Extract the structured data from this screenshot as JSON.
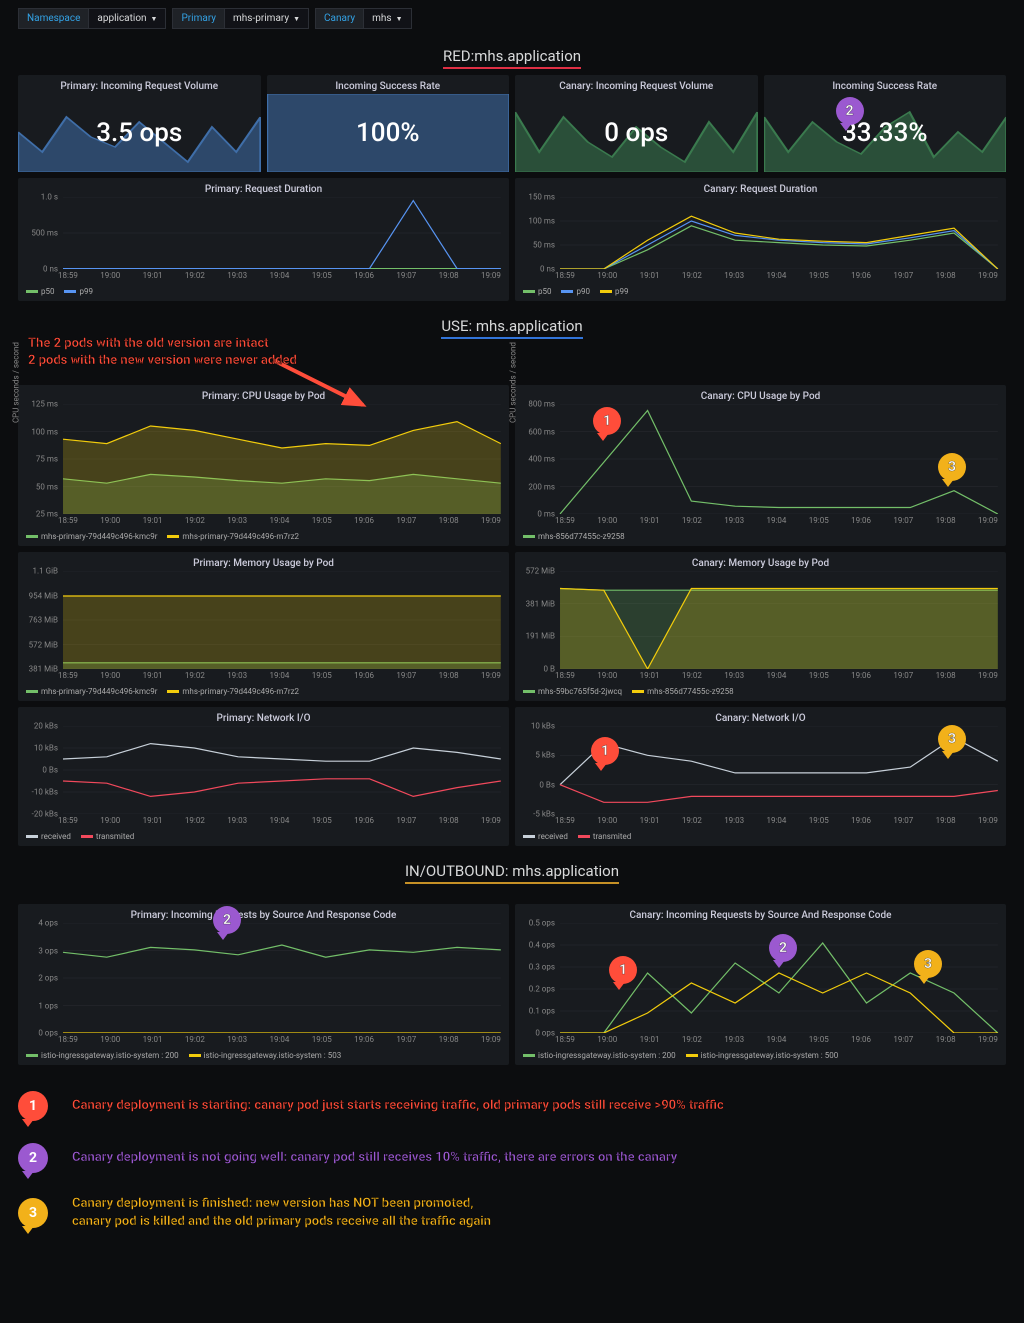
{
  "filters": {
    "namespace": {
      "label": "Namespace",
      "value": "application"
    },
    "primary": {
      "label": "Primary",
      "value": "mhs-primary"
    },
    "canary": {
      "label": "Canary",
      "value": "mhs"
    }
  },
  "sections": {
    "red": "RED:mhs.application",
    "use": "USE: mhs.application",
    "io": "IN/OUTBOUND: mhs.application"
  },
  "annotations": {
    "top": "The 2 pods with the old version are intact\n2 pods with the new version were never added",
    "n1": "Canary deployment is starting: canary pod just starts receiving traffic, old primary pods still receive >90% traffic",
    "n2": "Canary deployment is not going well: canary pod still receives 10% traffic, there are errors on the canary",
    "n3": "Canary deployment is finished: new version has NOT been promoted,\ncanary pod is killed and the old primary pods receive all the traffic again"
  },
  "time_ticks": [
    "18:59",
    "19:00",
    "19:01",
    "19:02",
    "19:03",
    "19:04",
    "19:05",
    "19:06",
    "19:07",
    "19:08",
    "19:09"
  ],
  "colors": {
    "blue": "#5794f2",
    "green": "#73bf69",
    "yellow": "#f2cc0c",
    "red": "#f2495c",
    "grey": "#c7d0d9",
    "purple": "#9b59d0",
    "orange": "#f2b11a"
  },
  "chart_data": {
    "stat_panels": [
      {
        "id": "primary_vol",
        "title": "Primary: Incoming Request Volume",
        "value": "3.5 ops",
        "color": "#3f6ea8"
      },
      {
        "id": "primary_success",
        "title": "Incoming Success Rate",
        "value": "100%",
        "color": "#3f6ea8"
      },
      {
        "id": "canary_vol",
        "title": "Canary: Incoming Request Volume",
        "value": "0 ops",
        "color": "#3a7a4e"
      },
      {
        "id": "canary_success",
        "title": "Incoming Success Rate",
        "value": "33.33%",
        "color": "#3a7a4e"
      }
    ],
    "ts_panels": {
      "primary_req_duration": {
        "title": "Primary: Request Duration",
        "y_ticks": [
          "0 ns",
          "500 ms",
          "1.0 s"
        ],
        "ylim": [
          0,
          1000
        ],
        "series": [
          {
            "name": "p50",
            "color": "#73bf69",
            "values": [
              5,
              5,
              5,
              5,
              5,
              5,
              5,
              5,
              5,
              5,
              5
            ]
          },
          {
            "name": "p99",
            "color": "#5794f2",
            "values": [
              5,
              5,
              5,
              5,
              5,
              5,
              5,
              5,
              950,
              5,
              5
            ]
          }
        ]
      },
      "canary_req_duration": {
        "title": "Canary: Request Duration",
        "y_ticks": [
          "0 ns",
          "50 ms",
          "100 ms",
          "150 ms"
        ],
        "ylim": [
          0,
          150
        ],
        "series": [
          {
            "name": "p50",
            "color": "#73bf69",
            "values": [
              0,
              0,
              40,
              90,
              60,
              55,
              50,
              48,
              60,
              75,
              0
            ]
          },
          {
            "name": "p90",
            "color": "#5794f2",
            "values": [
              0,
              0,
              50,
              100,
              70,
              60,
              55,
              52,
              65,
              80,
              0
            ]
          },
          {
            "name": "p99",
            "color": "#f2cc0c",
            "values": [
              0,
              0,
              60,
              110,
              75,
              62,
              58,
              55,
              70,
              85,
              0
            ]
          }
        ]
      },
      "primary_cpu": {
        "title": "Primary: CPU Usage by Pod",
        "y_ticks": [
          "25 ms",
          "50 ms",
          "75 ms",
          "100 ms",
          "125 ms"
        ],
        "ylim": [
          0,
          125
        ],
        "ylabel": "CPU seconds / second",
        "series": [
          {
            "name": "mhs-primary-79d449c496-kmc9r",
            "color": "#73bf69",
            "values": [
              40,
              35,
              45,
              42,
              38,
              35,
              40,
              38,
              45,
              40,
              35
            ]
          },
          {
            "name": "mhs-primary-79d449c496-m7rz2",
            "color": "#f2cc0c",
            "values": [
              85,
              80,
              100,
              95,
              85,
              75,
              80,
              78,
              95,
              105,
              80
            ]
          }
        ],
        "stacked": true
      },
      "canary_cpu": {
        "title": "Canary: CPU Usage by Pod",
        "y_ticks": [
          "0 ms",
          "200 ms",
          "400 ms",
          "600 ms",
          "800 ms"
        ],
        "ylim": [
          0,
          850
        ],
        "ylabel": "CPU seconds / second",
        "series": [
          {
            "name": "mhs-856d77455c-z9258",
            "color": "#73bf69",
            "values": [
              0,
              400,
              800,
              100,
              60,
              50,
              50,
              50,
              50,
              180,
              0
            ]
          }
        ]
      },
      "primary_mem": {
        "title": "Primary: Memory Usage by Pod",
        "y_ticks": [
          "381 MiB",
          "572 MiB",
          "763 MiB",
          "954 MiB",
          "1.1 GiB"
        ],
        "ylim": [
          381,
          1150
        ],
        "series": [
          {
            "name": "mhs-primary-79d449c496-kmc9r",
            "color": "#73bf69",
            "values": [
              430,
              430,
              430,
              430,
              430,
              430,
              430,
              430,
              430,
              430,
              430
            ]
          },
          {
            "name": "mhs-primary-79d449c496-m7rz2",
            "color": "#f2cc0c",
            "values": [
              954,
              954,
              954,
              954,
              954,
              954,
              954,
              954,
              954,
              954,
              954
            ]
          }
        ],
        "stacked": true
      },
      "canary_mem": {
        "title": "Canary: Memory Usage by Pod",
        "y_ticks": [
          "0 B",
          "191 MiB",
          "381 MiB",
          "572 MiB"
        ],
        "ylim": [
          0,
          572
        ],
        "series": [
          {
            "name": "mhs-59bc765f5d-2jwcq",
            "color": "#73bf69",
            "values": [
              470,
              460,
              460,
              460,
              460,
              460,
              460,
              460,
              460,
              460,
              460
            ]
          },
          {
            "name": "mhs-856d77455c-z9258",
            "color": "#f2cc0c",
            "values": [
              470,
              460,
              0,
              470,
              470,
              470,
              470,
              470,
              470,
              470,
              470
            ]
          }
        ],
        "stacked": true
      },
      "primary_net": {
        "title": "Primary: Network I/O",
        "y_ticks": [
          "-20 kBs",
          "-10 kBs",
          "0 Bs",
          "10 kBs",
          "20 kBs"
        ],
        "ylim": [
          -20,
          20
        ],
        "series": [
          {
            "name": "received",
            "color": "#c7d0d9",
            "values": [
              5,
              6,
              12,
              10,
              6,
              5,
              4,
              4,
              10,
              8,
              5
            ]
          },
          {
            "name": "transmited",
            "color": "#f2495c",
            "values": [
              -5,
              -6,
              -12,
              -10,
              -6,
              -5,
              -4,
              -4,
              -12,
              -8,
              -5
            ]
          }
        ]
      },
      "canary_net": {
        "title": "Canary: Network I/O",
        "y_ticks": [
          "-5 kBs",
          "0 Bs",
          "5 kBs",
          "10 kBs"
        ],
        "ylim": [
          -5,
          10
        ],
        "series": [
          {
            "name": "received",
            "color": "#c7d0d9",
            "values": [
              0,
              7,
              5,
              4,
              2,
              2,
              2,
              2,
              3,
              8,
              4
            ]
          },
          {
            "name": "transmited",
            "color": "#f2495c",
            "values": [
              0,
              -3,
              -3,
              -2,
              -2,
              -2,
              -2,
              -2,
              -2,
              -2,
              -1
            ]
          }
        ]
      },
      "primary_in": {
        "title": "Primary: Incoming Requests by Source And Response Code",
        "y_ticks": [
          "0 ops",
          "1 ops",
          "2 ops",
          "3 ops",
          "4 ops"
        ],
        "ylim": [
          0,
          4.5
        ],
        "series": [
          {
            "name": "istio-ingressgateway.istio-system : 200",
            "color": "#73bf69",
            "values": [
              3.3,
              3.1,
              3.5,
              3.4,
              3.2,
              3.6,
              3.1,
              3.4,
              3.3,
              3.5,
              3.4
            ]
          },
          {
            "name": "istio-ingressgateway.istio-system : 503",
            "color": "#f2cc0c",
            "values": [
              0,
              0,
              0,
              0,
              0,
              0,
              0,
              0,
              0,
              0,
              0
            ]
          }
        ]
      },
      "canary_in": {
        "title": "Canary: Incoming Requests by Source And Response Code",
        "y_ticks": [
          "0 ops",
          "0.1 ops",
          "0.2 ops",
          "0.3 ops",
          "0.4 ops",
          "0.5 ops"
        ],
        "ylim": [
          0,
          0.55
        ],
        "series": [
          {
            "name": "istio-ingressgateway.istio-system : 200",
            "color": "#73bf69",
            "values": [
              0,
              0,
              0.3,
              0.1,
              0.35,
              0.2,
              0.45,
              0.15,
              0.3,
              0.2,
              0
            ]
          },
          {
            "name": "istio-ingressgateway.istio-system : 500",
            "color": "#f2cc0c",
            "values": [
              0,
              0,
              0.1,
              0.25,
              0.15,
              0.3,
              0.2,
              0.3,
              0.2,
              0,
              0
            ]
          }
        ]
      }
    }
  }
}
